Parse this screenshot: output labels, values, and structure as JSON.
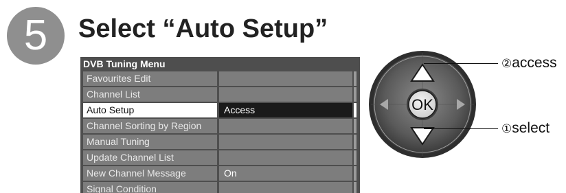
{
  "step": {
    "number": "5",
    "title": "Select “Auto Setup”"
  },
  "menu": {
    "title": "DVB Tuning Menu",
    "items": [
      {
        "label": "Favourites Edit",
        "value": "",
        "selected": false
      },
      {
        "label": "Channel List",
        "value": "",
        "selected": false
      },
      {
        "label": "Auto Setup",
        "value": "Access",
        "selected": true
      },
      {
        "label": "Channel Sorting by Region",
        "value": "",
        "selected": false
      },
      {
        "label": "Manual Tuning",
        "value": "",
        "selected": false
      },
      {
        "label": "Update Channel List",
        "value": "",
        "selected": false
      },
      {
        "label": "New Channel Message",
        "value": "On",
        "selected": false
      },
      {
        "label": "Signal Condition",
        "value": "",
        "selected": false
      }
    ]
  },
  "remote": {
    "ok_label": "OK",
    "access": {
      "number": "②",
      "text": "access"
    },
    "select": {
      "number": "①",
      "text": "select"
    }
  },
  "colors": {
    "menu_bg": "#4e4e4e",
    "row_bg": "#7d7d7d",
    "selected_label_bg": "#ffffff",
    "selected_value_bg": "#1a1a1a",
    "step_circle": "#8f8f8f"
  }
}
